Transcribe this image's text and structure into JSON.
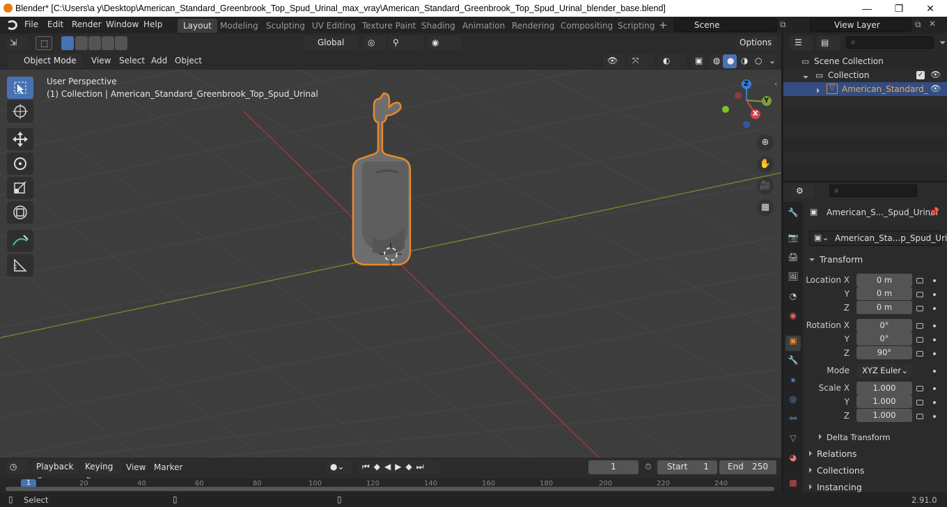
{
  "window": {
    "title": "Blender* [C:\\Users\\a y\\Desktop\\American_Standard_Greenbrook_Top_Spud_Urinal_max_vray\\American_Standard_Greenbrook_Top_Spud_Urinal_blender_base.blend]",
    "minimize": "—",
    "maximize": "❐",
    "close": "✕"
  },
  "menu": {
    "file": "File",
    "edit": "Edit",
    "render": "Render",
    "window": "Window",
    "help": "Help"
  },
  "workspaces": [
    "Layout",
    "Modeling",
    "Sculpting",
    "UV Editing",
    "Texture Paint",
    "Shading",
    "Animation",
    "Rendering",
    "Compositing",
    "Scripting"
  ],
  "scene": {
    "name": "Scene",
    "view_layer": "View Layer"
  },
  "viewport_header": {
    "orientation": "Global",
    "options": "Options",
    "mode": "Object Mode",
    "view": "View",
    "select": "Select",
    "add": "Add",
    "object": "Object"
  },
  "viewport": {
    "perspective": "User Perspective",
    "collection_info": "(1) Collection | American_Standard_Greenbrook_Top_Spud_Urinal",
    "gizmo_x": "X",
    "gizmo_y": "Y",
    "gizmo_z": "Z"
  },
  "outliner": {
    "scene_collection": "Scene Collection",
    "collection": "Collection",
    "object": "American_Standard_"
  },
  "properties": {
    "object_name": "American_S..._Spud_Urinal",
    "data_name": "American_Sta...p_Spud_Urinal",
    "transform": "Transform",
    "location_label": "Location X",
    "rotation_label": "Rotation X",
    "scale_label": "Scale X",
    "y": "Y",
    "z": "Z",
    "location": [
      "0 m",
      "0 m",
      "0 m"
    ],
    "rotation": [
      "0°",
      "0°",
      "90°"
    ],
    "mode_label": "Mode",
    "mode": "XYZ Euler",
    "scale": [
      "1.000",
      "1.000",
      "1.000"
    ],
    "delta": "Delta Transform",
    "relations": "Relations",
    "collections": "Collections",
    "instancing": "Instancing"
  },
  "timeline": {
    "playback": "Playback",
    "keying": "Keying",
    "view": "View",
    "marker": "Marker",
    "current_frame": "1",
    "start_label": "Start",
    "start": "1",
    "end_label": "End",
    "end": "250",
    "ruler": [
      "1",
      "20",
      "40",
      "60",
      "80",
      "100",
      "120",
      "140",
      "160",
      "180",
      "200",
      "220",
      "240"
    ]
  },
  "status": {
    "select": "Select",
    "version": "2.91.0"
  },
  "colors": {
    "accent": "#4772b3",
    "selection_outline": "#e8892a",
    "x_axis": "#c0393b",
    "y_axis": "#7ea03a"
  }
}
